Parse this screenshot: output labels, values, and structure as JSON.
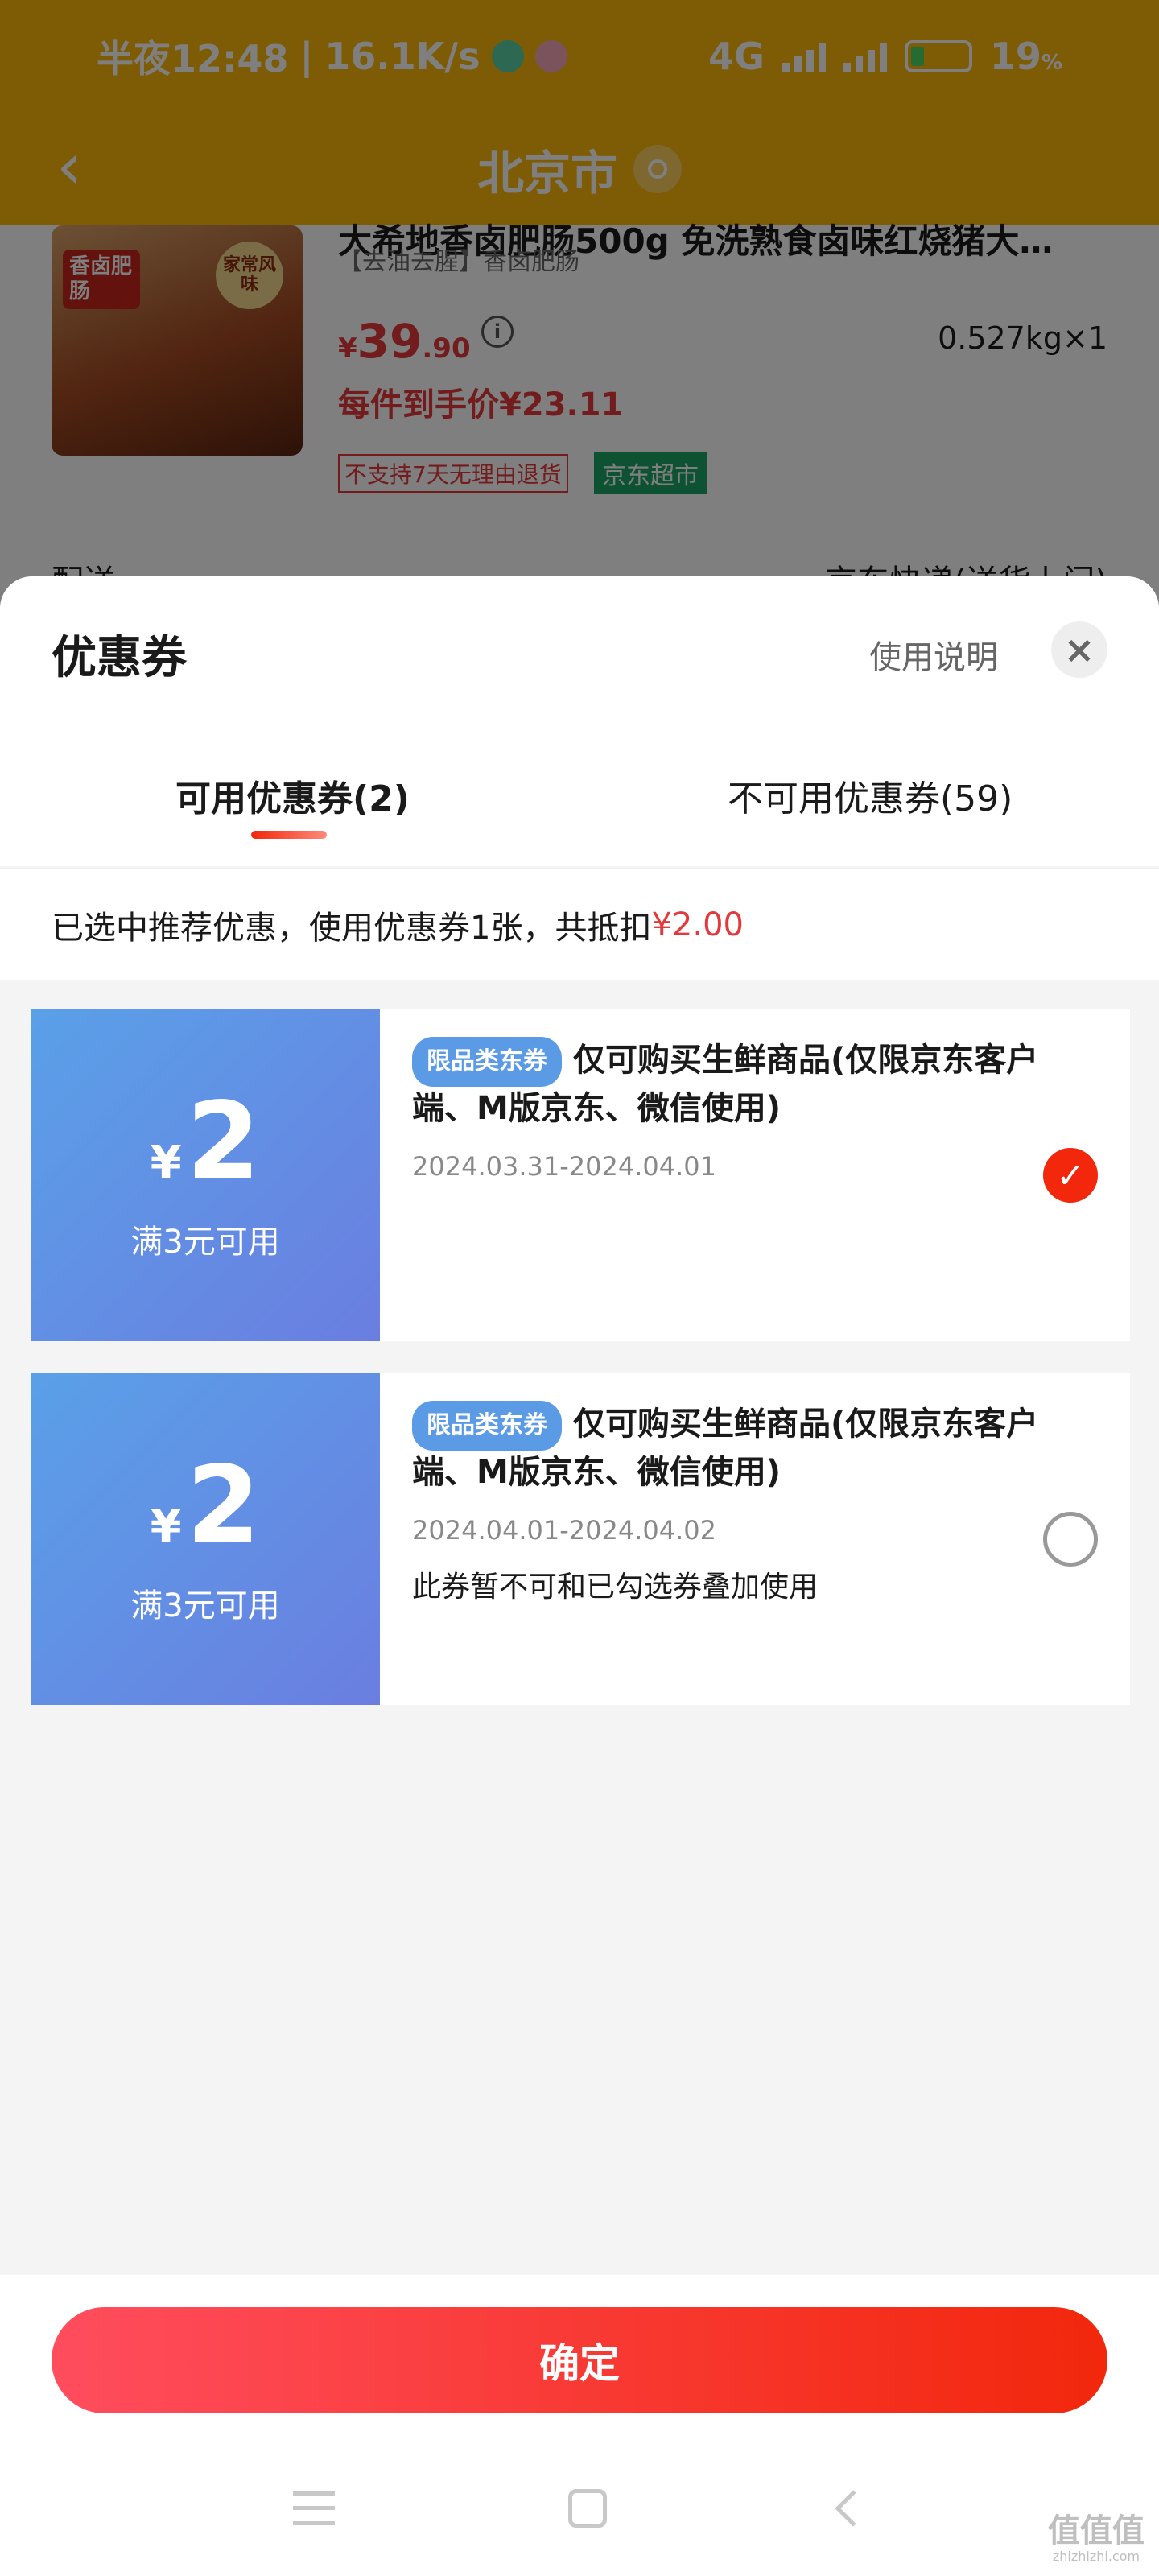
{
  "status_bar": {
    "time": "半夜12:48",
    "speed": "16.1K/s",
    "network": "4G",
    "battery": "19",
    "battery_unit": "%"
  },
  "nav": {
    "title": "北京市"
  },
  "product": {
    "title": "大希地香卤肥肠500g 免洗熟食卤味红烧猪大…",
    "subtitle": "【去油去腥】香卤肥肠",
    "price_currency": "¥",
    "price_int": "39",
    "price_dec": ".90",
    "weight": "0.527kg×1",
    "final_price": "每件到手价¥23.11",
    "badge_no_return": "不支持7天无理由退货",
    "badge_store": "京东超市",
    "image_tag1": "香卤肥肠",
    "image_tag2": "家常风味"
  },
  "delivery": {
    "label": "配送",
    "value": "京东快递(送货上门)"
  },
  "sheet": {
    "title": "优惠券",
    "usage_link": "使用说明",
    "close_symbol": "×",
    "tabs": [
      {
        "label": "可用优惠券(2)"
      },
      {
        "label": "不可用优惠券(59)"
      }
    ],
    "summary_prefix": "已选中推荐优惠，使用优惠券1张，共抵扣",
    "summary_amount": "¥2.00"
  },
  "coupons": [
    {
      "currency": "¥",
      "amount": "2",
      "condition": "满3元可用",
      "tag": "限品类东券",
      "title": "仅可购买生鲜商品(仅限京东客户端、M版京东、微信使用)",
      "date": "2024.03.31-2024.04.01",
      "note": "",
      "selected": true
    },
    {
      "currency": "¥",
      "amount": "2",
      "condition": "满3元可用",
      "tag": "限品类东券",
      "title": "仅可购买生鲜商品(仅限京东客户端、M版京东、微信使用)",
      "date": "2024.04.01-2024.04.02",
      "note": "此券暂不可和已勾选券叠加使用",
      "selected": false
    }
  ],
  "footer": {
    "confirm_label": "确定"
  },
  "watermark": {
    "text": "值值值",
    "url": "zhizhizhi.com"
  },
  "colors": {
    "status_bg": "#fdb80a",
    "accent_red": "#e4393c",
    "coupon_blue": "#5aa0e8",
    "store_green": "#1aa566"
  }
}
